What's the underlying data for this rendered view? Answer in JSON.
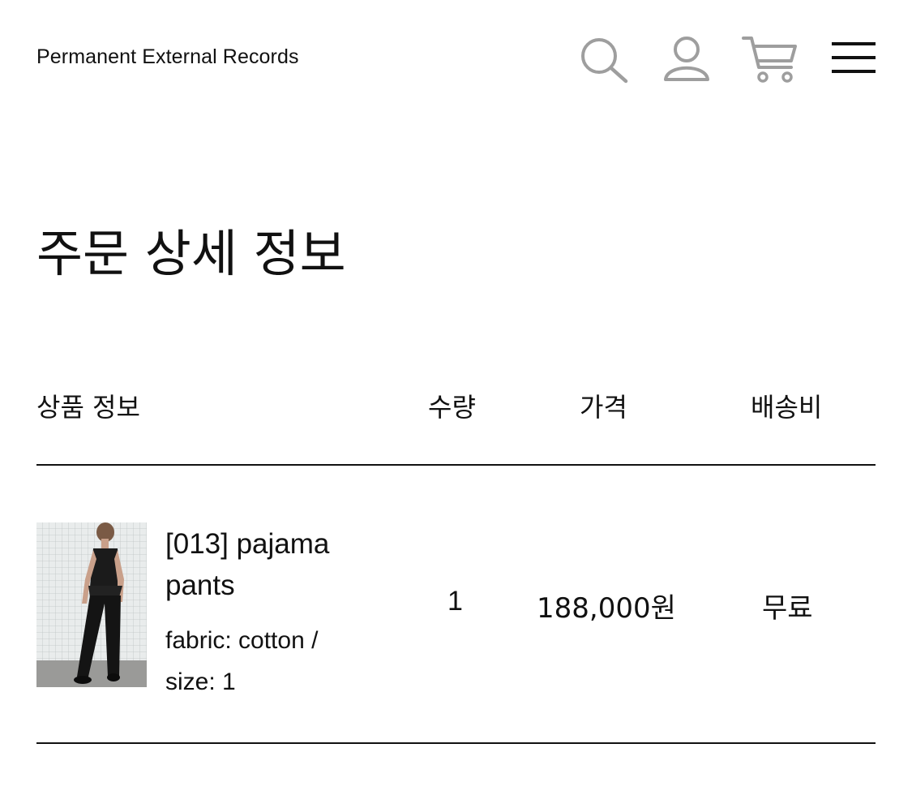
{
  "header": {
    "brand": "Permanent External Records",
    "icons": [
      "search-icon",
      "user-icon",
      "cart-icon",
      "menu-icon"
    ]
  },
  "page": {
    "title": "주문 상세 정보"
  },
  "table": {
    "headers": {
      "product": "상품 정보",
      "quantity": "수량",
      "price": "가격",
      "shipping": "배송비"
    },
    "rows": [
      {
        "name": "[013] pajama pants",
        "options": "fabric: cotton / size: 1",
        "quantity": "1",
        "price": "188,000원",
        "shipping": "무료"
      }
    ]
  },
  "colors": {
    "text": "#111111",
    "icon_gray": "#9e9e9e",
    "background": "#ffffff"
  }
}
